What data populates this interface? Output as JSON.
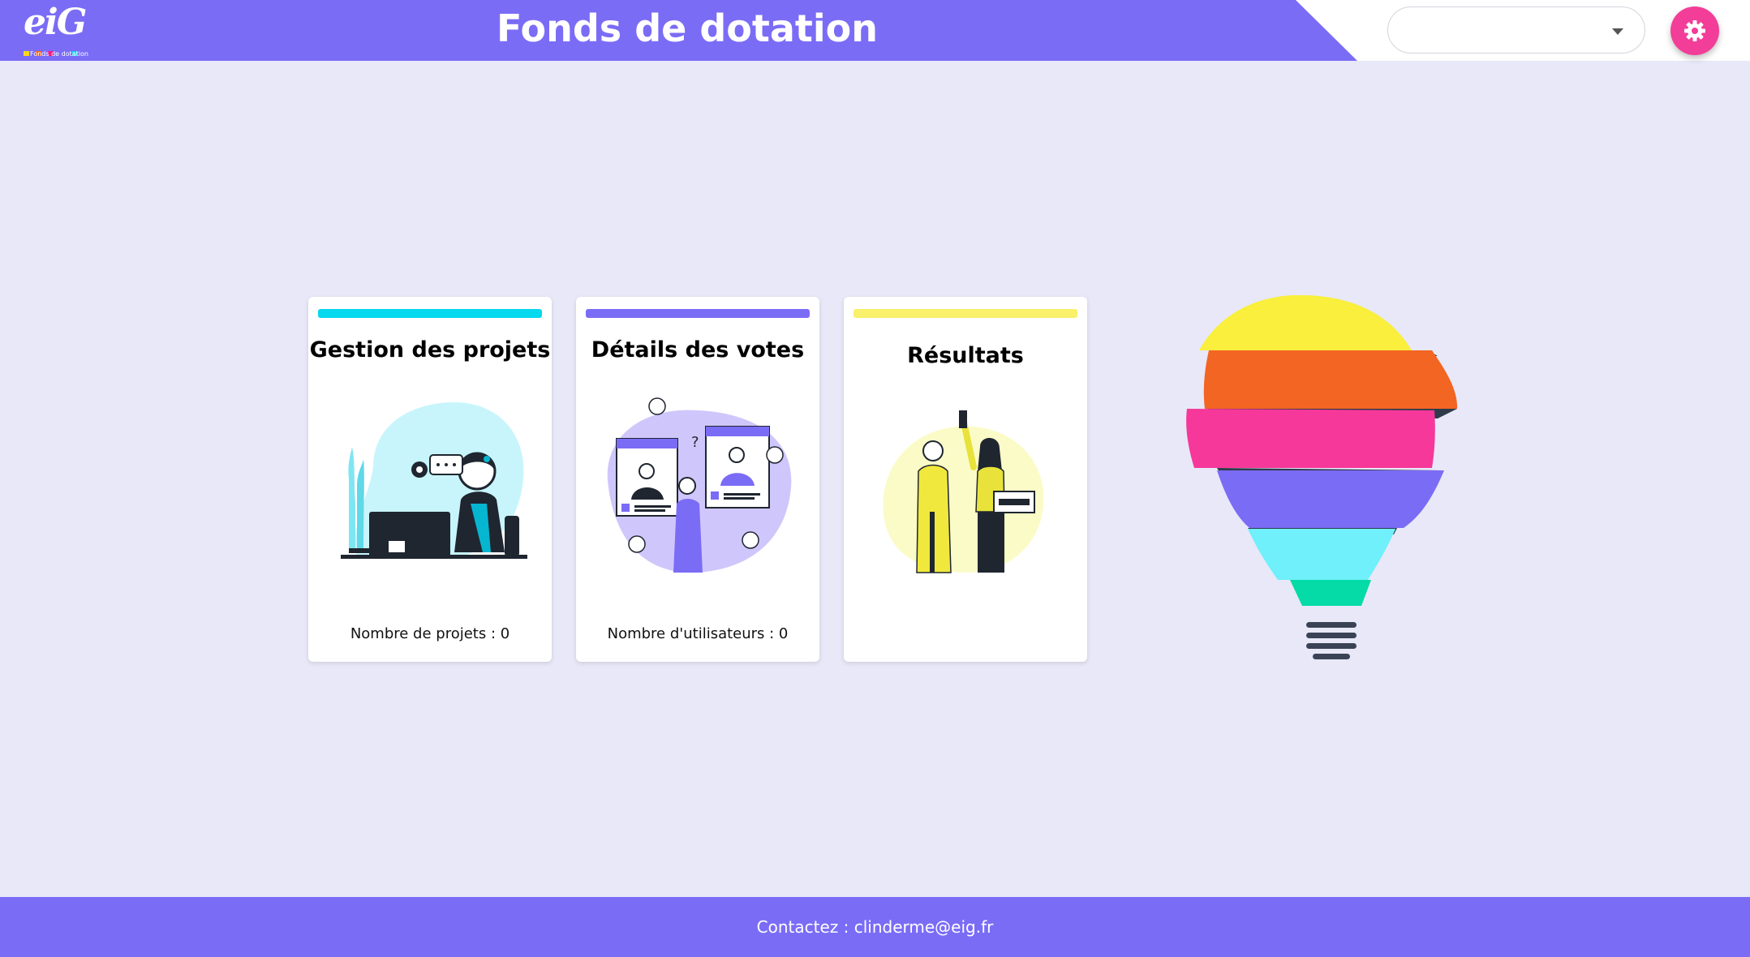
{
  "header": {
    "title": "Fonds de dotation",
    "logo_text": "eiG",
    "logo_subtitle": "Fonds de dotation",
    "select_value": ""
  },
  "cards": [
    {
      "title": "Gestion des projets",
      "footer": "Nombre de projets : 0",
      "bar_color": "#06d8ee",
      "illustration": "call-center-illustration"
    },
    {
      "title": "Détails des votes",
      "footer": "Nombre d'utilisateurs : 0",
      "bar_color": "#7b6cf6",
      "illustration": "vote-illustration"
    },
    {
      "title": "Résultats",
      "footer": "",
      "bar_color": "#f9f06b",
      "illustration": "winners-illustration"
    }
  ],
  "footer": {
    "contact": "Contactez : clinderme@eig.fr"
  },
  "colors": {
    "brand_purple": "#7b6cf6",
    "accent_pink": "#f23e98",
    "background": "#e8e8f8"
  },
  "icons": [
    "gear-icon",
    "chevron-down-icon",
    "lightbulb-icon"
  ]
}
